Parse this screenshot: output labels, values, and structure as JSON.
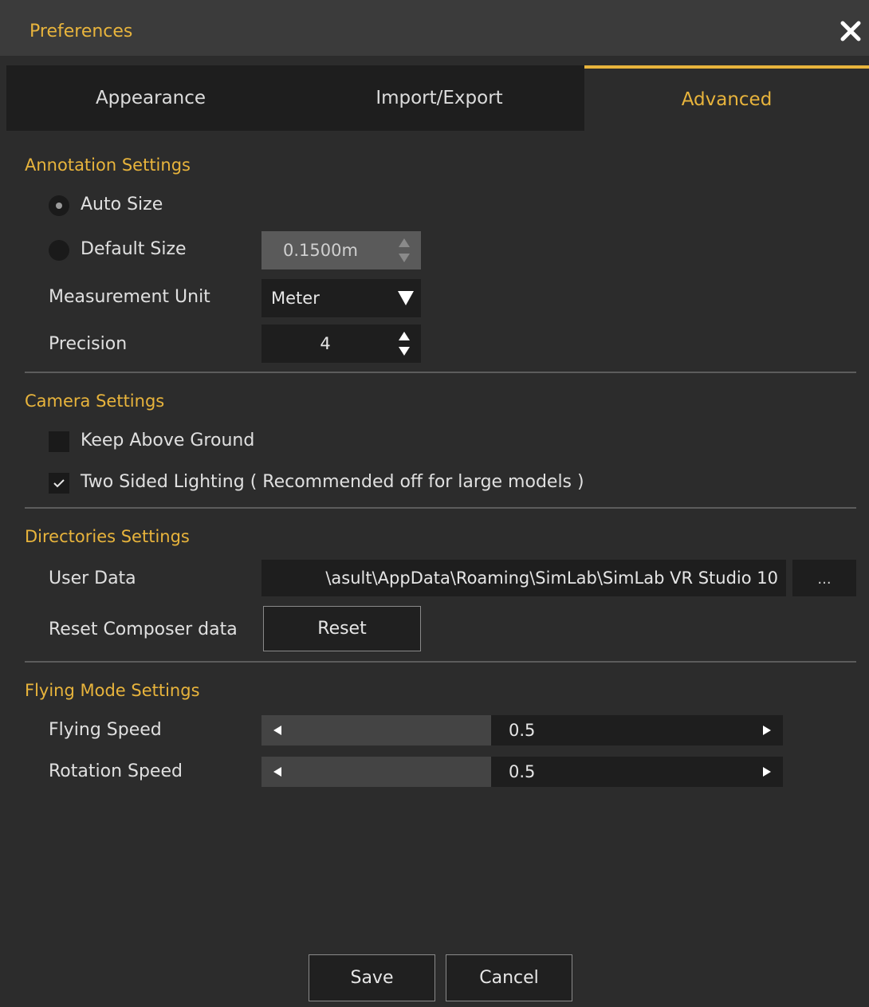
{
  "window": {
    "title": "Preferences"
  },
  "tabs": [
    {
      "label": "Appearance",
      "active": false
    },
    {
      "label": "Import/Export",
      "active": false
    },
    {
      "label": "Advanced",
      "active": true
    }
  ],
  "annotation": {
    "section_title": "Annotation Settings",
    "auto_size_label": "Auto Size",
    "auto_size_selected": true,
    "default_size_label": "Default Size",
    "default_size_value": "0.1500m",
    "measurement_unit_label": "Measurement Unit",
    "measurement_unit_value": "Meter",
    "precision_label": "Precision",
    "precision_value": "4"
  },
  "camera": {
    "section_title": "Camera Settings",
    "keep_above_ground_label": "Keep Above Ground",
    "keep_above_ground_checked": false,
    "two_sided_lighting_label": "Two Sided Lighting ( Recommended off for large models )",
    "two_sided_lighting_checked": true
  },
  "directories": {
    "section_title": "Directories Settings",
    "user_data_label": "User Data",
    "user_data_value": "\\asult\\AppData\\Roaming\\SimLab\\SimLab VR Studio 10",
    "browse_label": "...",
    "reset_composer_label": "Reset Composer data",
    "reset_button_label": "Reset"
  },
  "flying": {
    "section_title": "Flying Mode Settings",
    "flying_speed_label": "Flying Speed",
    "flying_speed_value": "0.5",
    "flying_speed_fraction": 0.5,
    "rotation_speed_label": "Rotation Speed",
    "rotation_speed_value": "0.5",
    "rotation_speed_fraction": 0.5
  },
  "footer": {
    "save_label": "Save",
    "cancel_label": "Cancel"
  },
  "colors": {
    "accent": "#e8b43c",
    "background": "#2c2c2c",
    "field": "#1e1e1e"
  },
  "icons": [
    "close-icon",
    "spin-up-icon",
    "spin-down-icon",
    "dropdown-arrow-icon",
    "checkmark-icon",
    "slider-left-arrow-icon",
    "slider-right-arrow-icon"
  ]
}
